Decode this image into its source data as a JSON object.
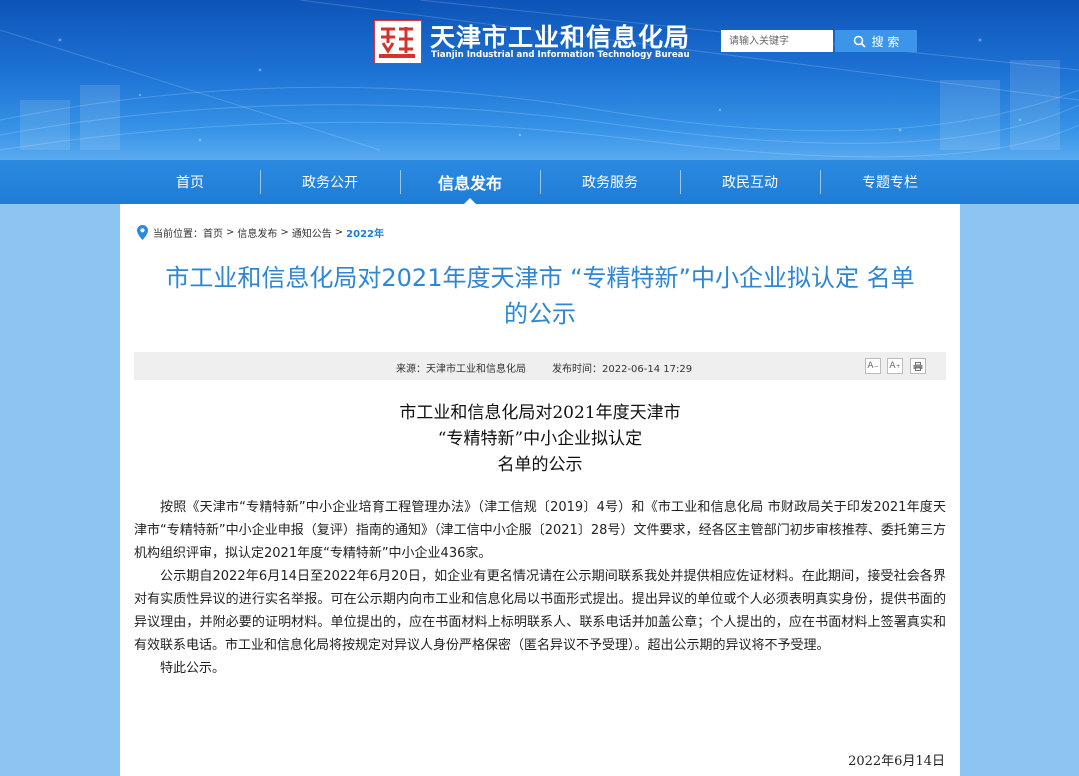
{
  "header": {
    "emblem_text": "天津",
    "site_title": "天津市工业和信息化局",
    "site_subtitle": "Tianjin Industrial and Information Technology Bureau",
    "search": {
      "placeholder": "请输入关键字",
      "button_label": "搜 索"
    }
  },
  "nav": {
    "items": [
      {
        "label": "首页"
      },
      {
        "label": "政务公开"
      },
      {
        "label": "信息发布",
        "active": true
      },
      {
        "label": "政务服务"
      },
      {
        "label": "政民互动"
      },
      {
        "label": "专题专栏"
      }
    ]
  },
  "breadcrumb": {
    "prefix": "当前位置：",
    "items": [
      "首页",
      "信息发布",
      "通知公告",
      "2022年"
    ],
    "separator": ">"
  },
  "article": {
    "title": "市工业和信息化局对2021年度天津市 “专精特新”中小企业拟认定 名单的公示",
    "source_label": "来源：",
    "source": "天津市工业和信息化局",
    "time_label": "发布时间：",
    "time": "2022-06-14 17:29",
    "tools": {
      "font_smaller": "A",
      "font_larger": "A",
      "print_icon": "print-icon"
    },
    "doc_title_lines": [
      "市工业和信息化局对2021年度天津市",
      "“专精特新”中小企业拟认定",
      "名单的公示"
    ],
    "paragraphs": [
      "按照《天津市“专精特新”中小企业培育工程管理办法》（津工信规〔2019〕4号）和《市工业和信息化局 市财政局关于印发2021年度天津市“专精特新”中小企业申报（复评）指南的通知》（津工信中小企服〔2021〕28号）文件要求，经各区主管部门初步审核推荐、委托第三方机构组织评审，拟认定2021年度“专精特新”中小企业436家。",
      "公示期自2022年6月14日至2022年6月20日，如企业有更名情况请在公示期间联系我处并提供相应佐证材料。在此期间，接受社会各界对有实质性异议的进行实名举报。可在公示期内向市工业和信息化局以书面形式提出。提出异议的单位或个人必须表明真实身份，提供书面的异议理由，并附必要的证明材料。单位提出的，应在书面材料上标明联系人、联系电话并加盖公章；个人提出的，应在书面材料上签署真实和有效联系电话。市工业和信息化局将按规定对异议人身份严格保密（匿名异议不予受理）。超出公示期的异议将不予受理。",
      "特此公示。"
    ],
    "date": "2022年6月14日"
  },
  "colors": {
    "accent": "#1f7cd6",
    "title_blue": "#2d86d6",
    "page_bg": "#8cc5f2"
  }
}
